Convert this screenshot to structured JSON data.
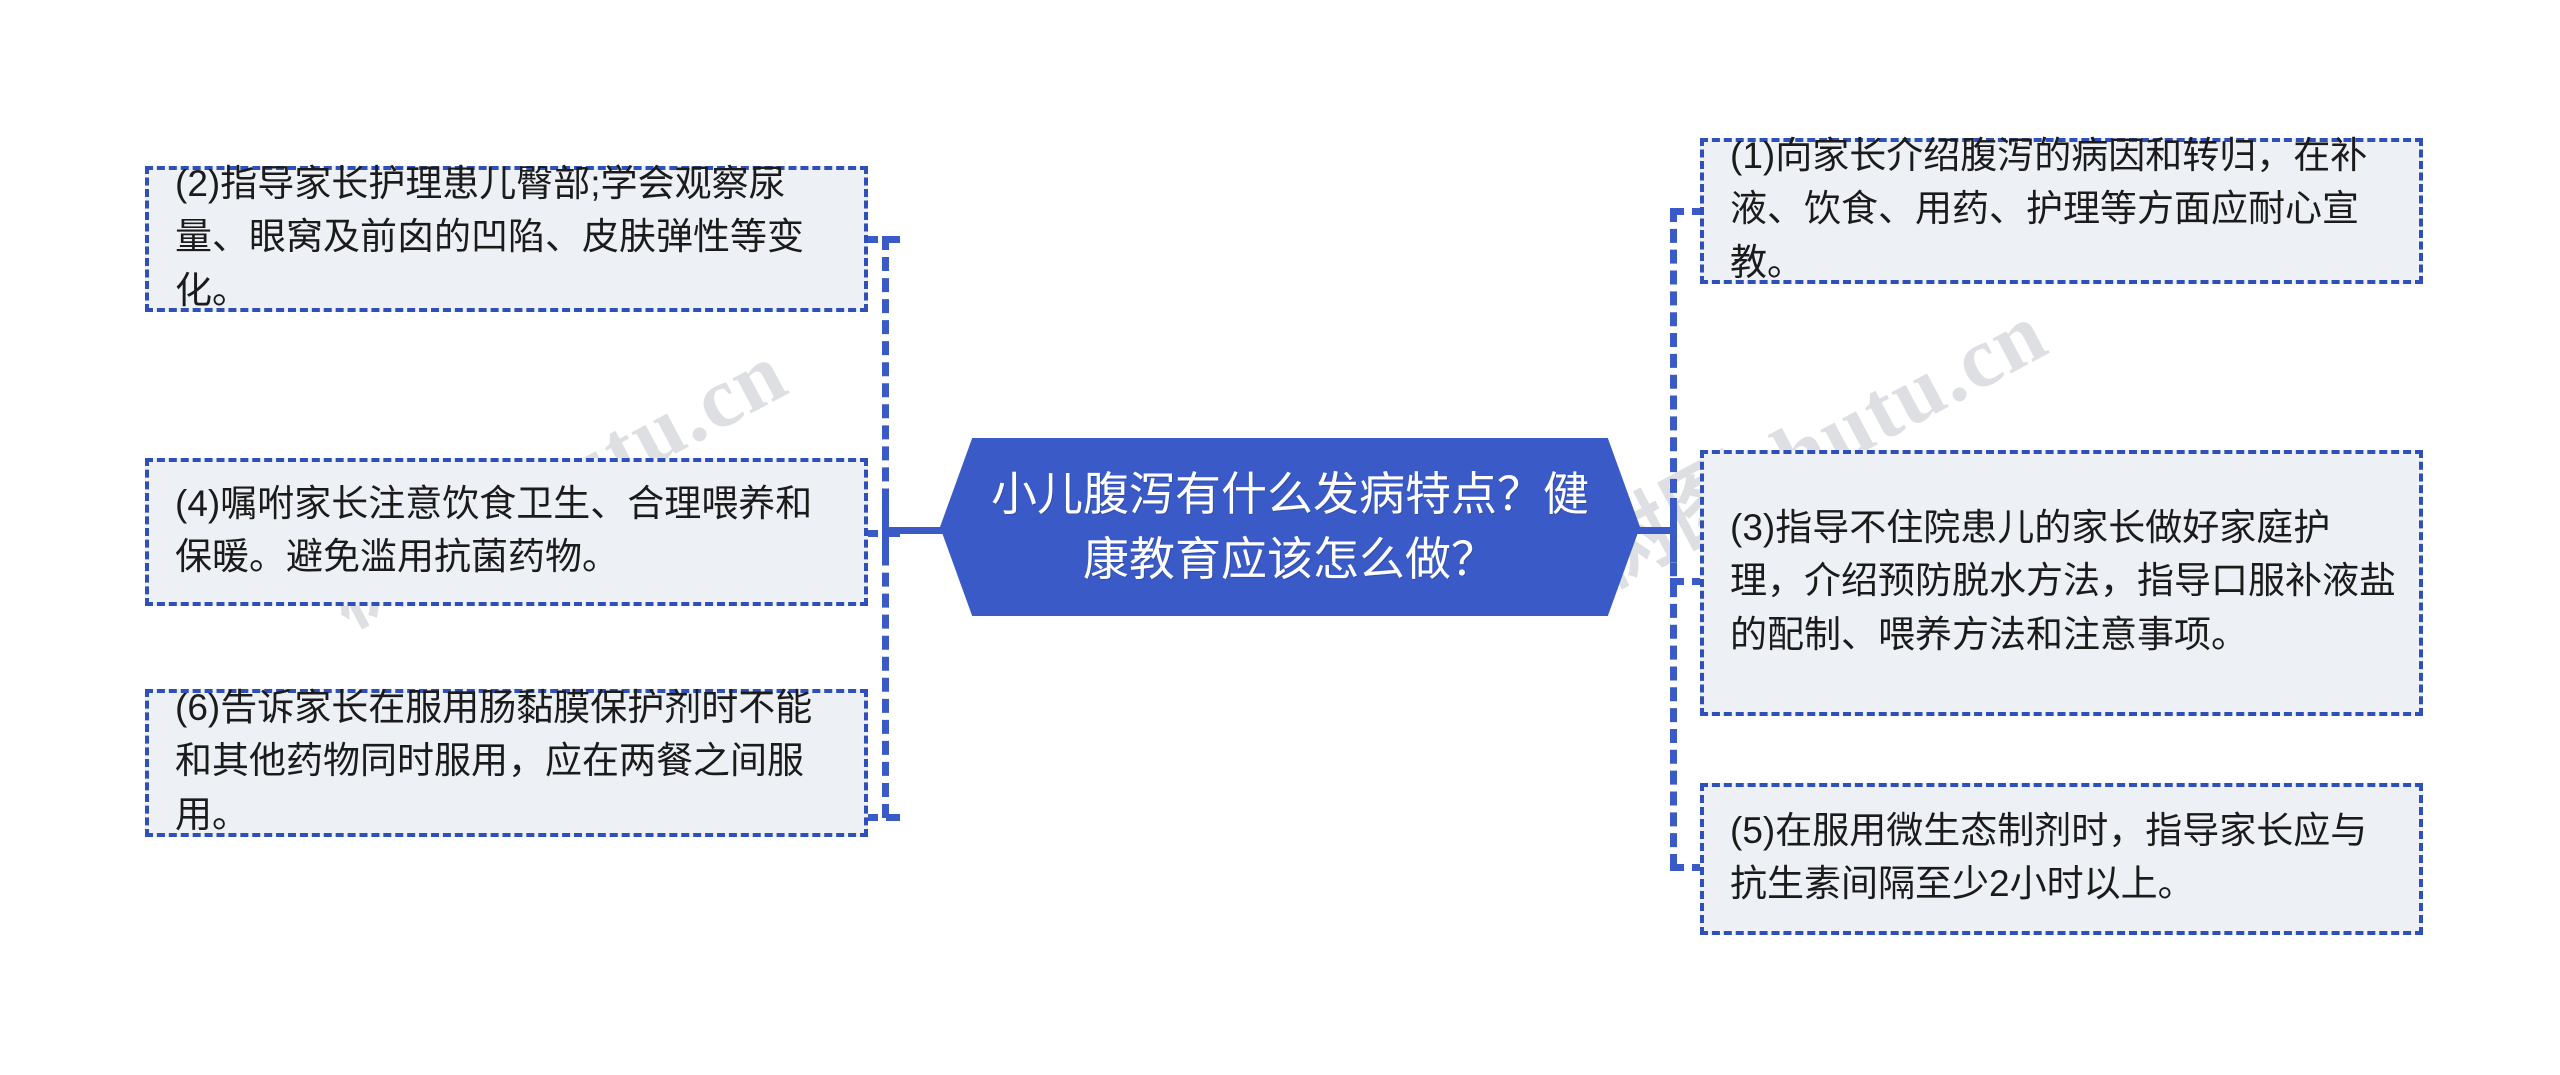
{
  "diagram": {
    "type": "mindmap",
    "title": "小儿腹泻健康教育思维导图",
    "center": {
      "label": "小儿腹泻有什么发病特点？健康教育应该怎么做？",
      "shape": "hexagon",
      "fill_color": "#3a5bc7",
      "text_color": "#ffffff"
    },
    "branch_style": {
      "line_color": "#3a5bc7",
      "line_style": "dashed",
      "box_fill": "#edf0f4",
      "box_border": "#2f50b8"
    },
    "left_branch": {
      "side": "left",
      "items": [
        {
          "id": "node-2",
          "index": "(2)",
          "label": "(2)指导家长护理患儿臀部;学会观察尿量、眼窝及前囟的凹陷、皮肤弹性等变化。"
        },
        {
          "id": "node-4",
          "index": "(4)",
          "label": "(4)嘱咐家长注意饮食卫生、合理喂养和保暖。避免滥用抗菌药物。"
        },
        {
          "id": "node-6",
          "index": "(6)",
          "label": "(6)告诉家长在服用肠黏膜保护剂时不能和其他药物同时服用，应在两餐之间服用。"
        }
      ]
    },
    "right_branch": {
      "side": "right",
      "items": [
        {
          "id": "node-1",
          "index": "(1)",
          "label": "(1)向家长介绍腹泻的病因和转归，在补液、饮食、用药、护理等方面应耐心宣教。"
        },
        {
          "id": "node-3",
          "index": "(3)",
          "label": "(3)指导不住院患儿的家长做好家庭护理，介绍预防脱水方法，指导口服补液盐的配制、喂养方法和注意事项。"
        },
        {
          "id": "node-5",
          "index": "(5)",
          "label": "(5)在服用微生态制剂时，指导家长应与抗生素间隔至少2小时以上。"
        }
      ]
    }
  },
  "watermark": {
    "text_left": "树图shutu.cn",
    "text_right": "树图shutu.cn",
    "color": "#c9cdd2"
  }
}
